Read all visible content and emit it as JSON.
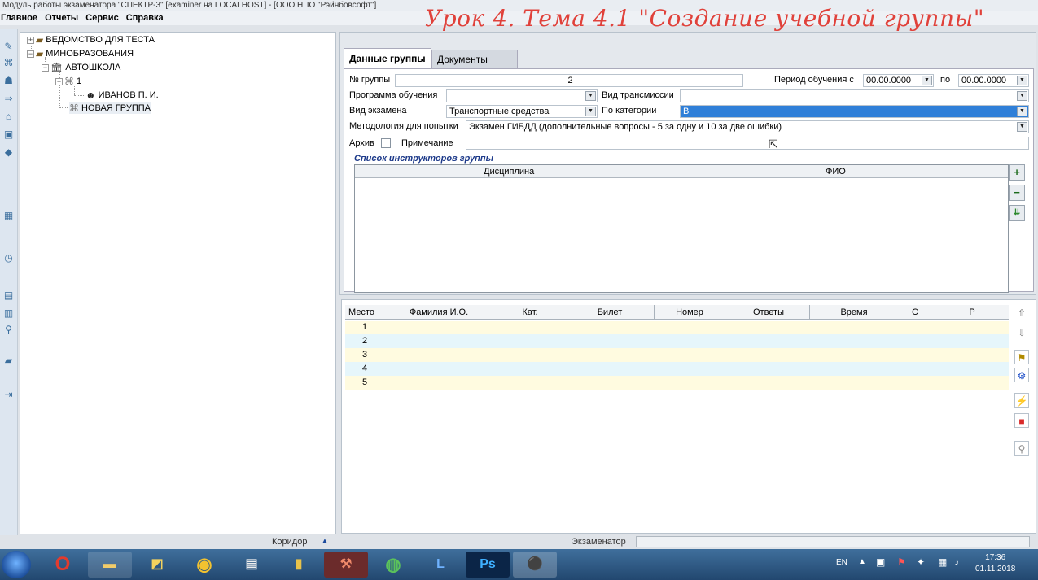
{
  "window": {
    "title": "Модуль работы экзаменатора \"СПЕКТР-3\" [examiner на LOCALHOST] - [ООО НПО \"Рэйнбовсофт\"]"
  },
  "menu": [
    "Главное",
    "Отчеты",
    "Сервис",
    "Справка"
  ],
  "overlay_title": "Урок 4. Тема 4.1 \"Создание учебной группы\"",
  "tree": {
    "nodes": [
      {
        "label": "ВЕДОМСТВО ДЛЯ ТЕСТА"
      },
      {
        "label": "МИНОБРАЗОВАНИЯ"
      },
      {
        "label": "АВТОШКОЛА"
      },
      {
        "label": "1"
      },
      {
        "label": "ИВАНОВ П. И."
      },
      {
        "label": "НОВАЯ ГРУППА"
      }
    ]
  },
  "tabs": [
    "Данные группы",
    "Документы"
  ],
  "form": {
    "group_no_label": "№ группы",
    "group_no_value": "2",
    "period_label": "Период обучения с",
    "period_from": "00.00.0000",
    "period_to_label": "по",
    "period_to": "00.00.0000",
    "program_label": "Программа обучения",
    "program_value": "",
    "transmission_label": "Вид трансмиссии",
    "transmission_value": "",
    "exam_type_label": "Вид экзамена",
    "exam_type_value": "Транспортные средства",
    "category_label": "По категории",
    "category_value": "B",
    "method_label": "Методология для попытки",
    "method_value": "Экзамен ГИБДД (дополнительные вопросы - 5 за одну и 10 за две ошибки)",
    "archive_label": "Архив",
    "note_label": "Примечание",
    "note_value": ""
  },
  "instructors": {
    "title": "Список инструкторов группы",
    "columns": [
      "Дисциплина",
      "ФИО"
    ]
  },
  "exam_grid": {
    "columns": [
      "Место",
      "Фамилия И.О.",
      "Кат.",
      "Билет",
      "Номер",
      "Ответы",
      "Время",
      "С",
      "Р"
    ],
    "rows": [
      "1",
      "2",
      "3",
      "4",
      "5"
    ]
  },
  "statusbar": {
    "corridor": "Коридор",
    "examiner": "Экзаменатор"
  },
  "tray": {
    "lang": "EN",
    "time": "17:36",
    "date": "01.11.2018"
  },
  "colors": {
    "overlay_title": "#e0413a",
    "selection": "#2f7fd8",
    "row_even": "#fffbe0",
    "row_odd": "#e6f6fb"
  }
}
